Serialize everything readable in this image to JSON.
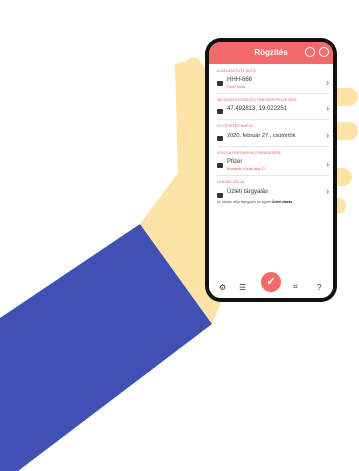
{
  "app": {
    "title": "Rögzítés"
  },
  "sections": [
    {
      "label": "KIVÁLASZTOTT AUTÓ",
      "main": "HHH-666",
      "sub": "Ford Transit"
    },
    {
      "label": "JELENLEGI POZÍCIÓ / PARTNER FELVÉTELE",
      "main": "47.492813, 19.022251",
      "sub": ""
    },
    {
      "label": "ÚJ TÉVÉTÉS NAPJA",
      "main": "2020. február 27., csütörtök",
      "sub": ""
    },
    {
      "label": "VISSZ A PARTNERHEZ RENDEZÉSE",
      "main": "Pfizer",
      "sub": "Budapest, Kőrösi utca 22."
    },
    {
      "label": "UTAZÁS CÉLJA",
      "main": "Üzleti tárgyalás",
      "sub": ""
    }
  ],
  "note": {
    "text": "Az utazás célja bejegyzés és egyéb",
    "bold": "Üzleti utazás"
  },
  "tabs": {
    "fab_glyph": "✓",
    "help_glyph": "?"
  },
  "colors": {
    "accent": "#f26b6b",
    "sleeve": "#3f51b5",
    "skin": "#fde4a6"
  }
}
